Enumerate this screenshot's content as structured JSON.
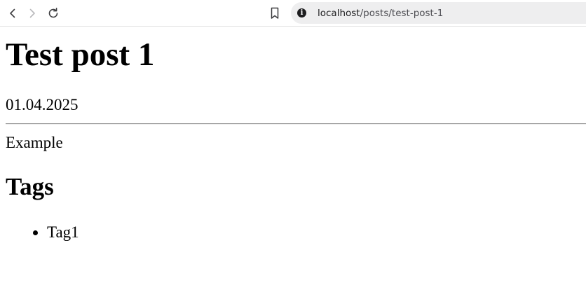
{
  "browser": {
    "url_host": "localhost",
    "url_path": "/posts/test-post-1",
    "icons": {
      "back": "back-arrow-icon",
      "forward": "forward-arrow-icon",
      "reload": "reload-icon",
      "bookmark": "bookmark-icon",
      "site_info": "info-icon"
    },
    "colors": {
      "address_bg": "#eeeeef",
      "nav_icon": "#3c3c3f",
      "nav_icon_disabled": "#b9b9bc"
    }
  },
  "post": {
    "title": "Test post 1",
    "date": "01.04.2025",
    "body": "Example",
    "tags_heading": "Tags",
    "tags": [
      "Tag1"
    ]
  }
}
